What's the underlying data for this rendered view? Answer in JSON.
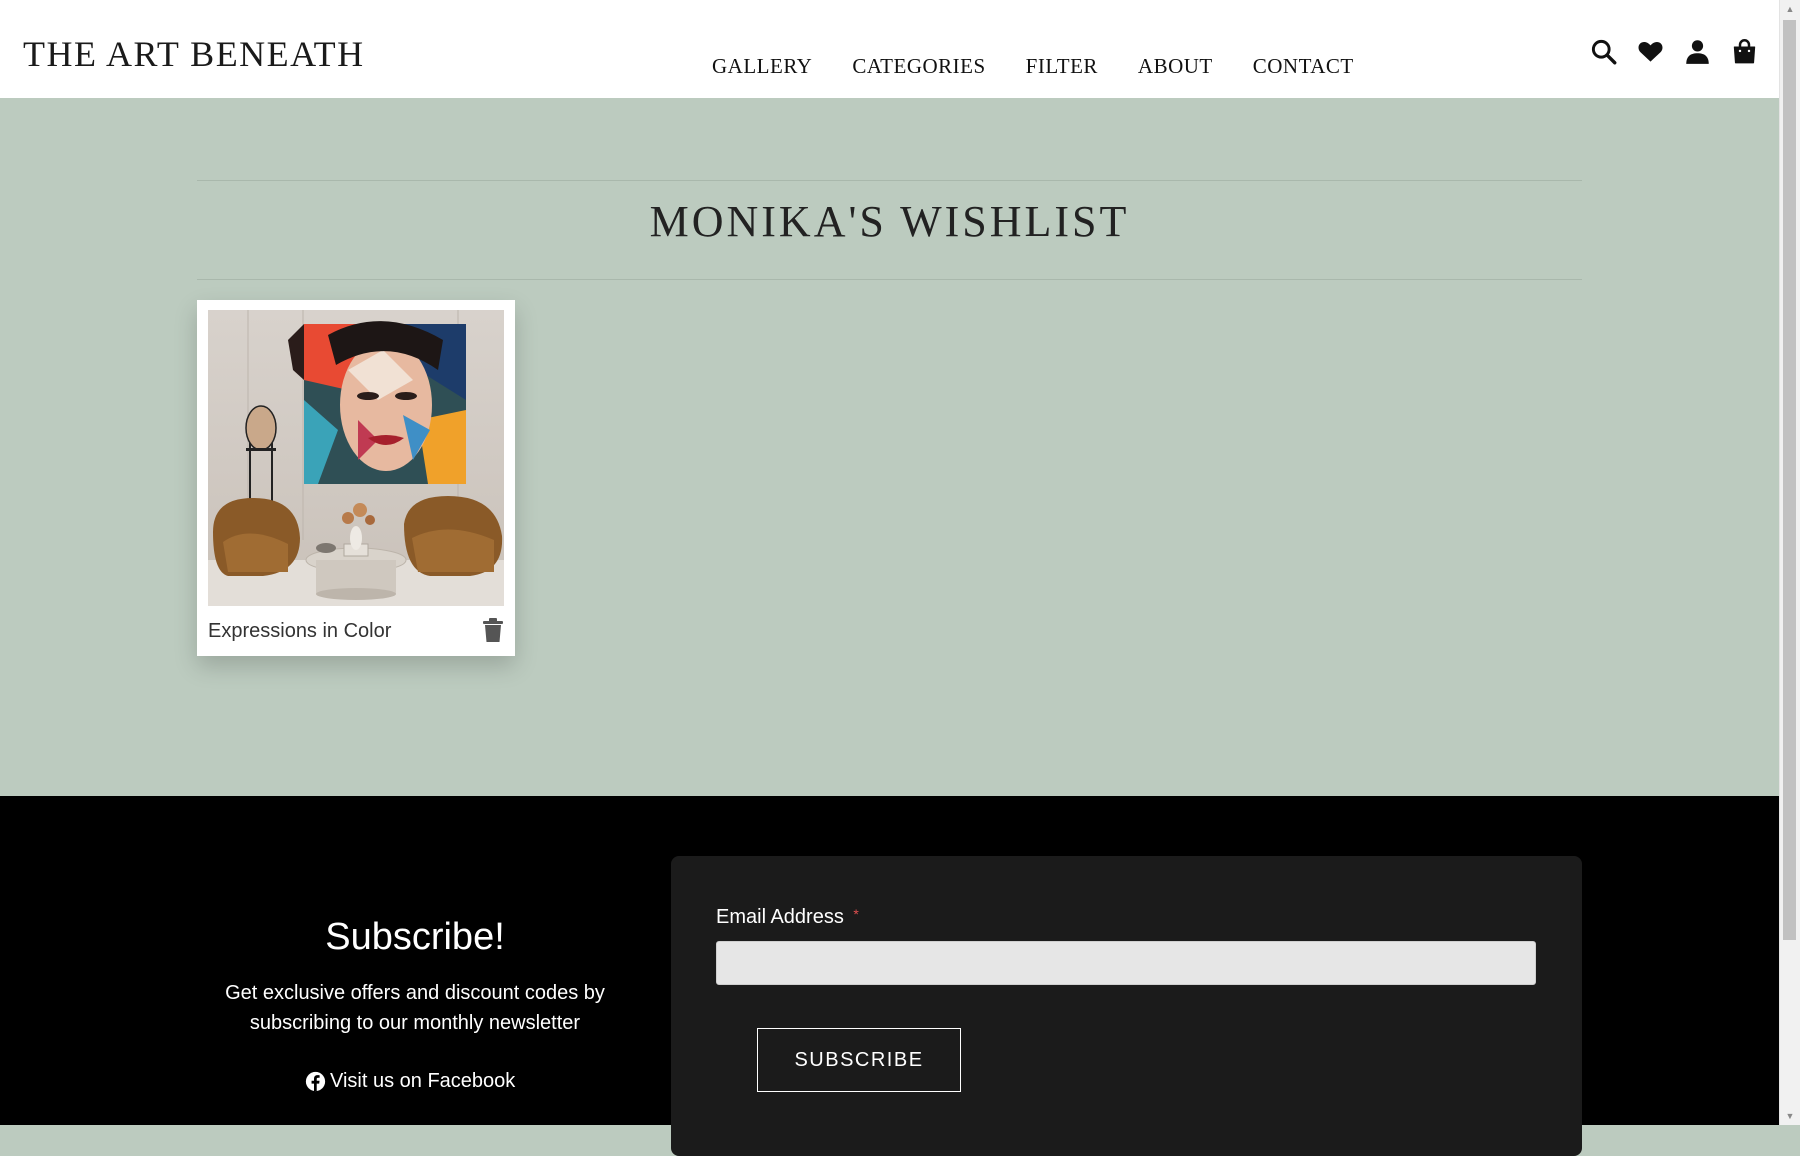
{
  "header": {
    "logo": "THE ART BENEATH",
    "nav": [
      "GALLERY",
      "CATEGORIES",
      "FILTER",
      "ABOUT",
      "CONTACT"
    ],
    "icons": [
      "search-icon",
      "heart-icon",
      "user-icon",
      "bag-icon"
    ]
  },
  "main": {
    "title": "MONIKA'S WISHLIST",
    "items": [
      {
        "title": "Expressions in Color",
        "action_icon": "trash-icon"
      }
    ]
  },
  "footer": {
    "subscribe_title": "Subscribe!",
    "subscribe_text": "Get exclusive offers and discount codes by subscribing to our monthly newsletter",
    "facebook_text": "Visit us on Facebook",
    "email_label": "Email Address",
    "required_mark": "*",
    "email_value": "",
    "button_label": "SUBSCRIBE"
  },
  "colors": {
    "page_background": "#bccbbf",
    "header_background": "#ffffff",
    "footer_background": "#000000",
    "form_panel": "#1b1b1b",
    "required": "#e05050"
  }
}
